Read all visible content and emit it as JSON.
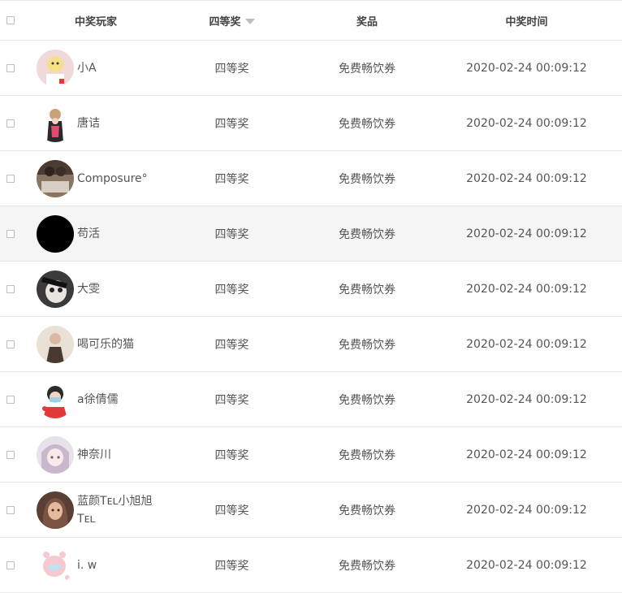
{
  "table": {
    "headers": {
      "player": "中奖玩家",
      "prize_level": "四等奖",
      "prize": "奖品",
      "time": "中奖时间"
    },
    "rows": [
      {
        "name": "小A",
        "prize_level": "四等奖",
        "prize": "免费畅饮券",
        "time": "2020-02-24 00:09:12"
      },
      {
        "name": "唐诘",
        "prize_level": "四等奖",
        "prize": "免费畅饮券",
        "time": "2020-02-24 00:09:12"
      },
      {
        "name": "Composure°",
        "prize_level": "四等奖",
        "prize": "免费畅饮券",
        "time": "2020-02-24 00:09:12"
      },
      {
        "name": "苟活",
        "prize_level": "四等奖",
        "prize": "免费畅饮券",
        "time": "2020-02-24 00:09:12"
      },
      {
        "name": "大雯",
        "prize_level": "四等奖",
        "prize": "免费畅饮券",
        "time": "2020-02-24 00:09:12"
      },
      {
        "name": "喝可乐的猫",
        "prize_level": "四等奖",
        "prize": "免费畅饮券",
        "time": "2020-02-24 00:09:12"
      },
      {
        "name": "a徐倩儒",
        "prize_level": "四等奖",
        "prize": "免费畅饮券",
        "time": "2020-02-24 00:09:12"
      },
      {
        "name": "神奈川",
        "prize_level": "四等奖",
        "prize": "免费畅饮券",
        "time": "2020-02-24 00:09:12"
      },
      {
        "name": "蓝颜Tᴇʟ小旭旭Tᴇʟ",
        "prize_level": "四等奖",
        "prize": "免费畅饮券",
        "time": "2020-02-24 00:09:12"
      },
      {
        "name": "i. w",
        "prize_level": "四等奖",
        "prize": "免费畅饮券",
        "time": "2020-02-24 00:09:12"
      }
    ]
  },
  "colors": {
    "border": "#e8e8e8",
    "hover_row": "#f5f5f5",
    "text": "#555555",
    "sort_arrow": "#bdbdbd"
  },
  "icons": {
    "sort": "sort-down-icon",
    "checkbox": "checkbox-icon"
  }
}
